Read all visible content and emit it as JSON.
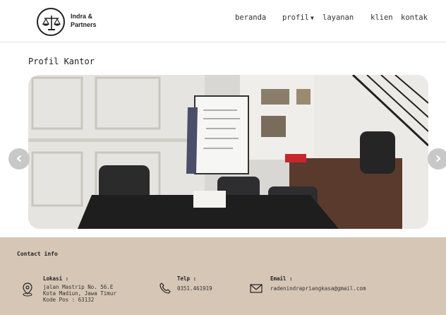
{
  "brand": {
    "name_line1": "Indra &",
    "name_line2": "Partners"
  },
  "nav": {
    "beranda": "beranda",
    "profil": "profil",
    "layanan": "layanan",
    "klien": "klien",
    "kontak": "kontak"
  },
  "main": {
    "title": "Profil Kantor"
  },
  "icons": {
    "logo": "scales-of-justice-icon",
    "dropdown": "chevron-down-icon",
    "carousel_prev": "chevron-left-icon",
    "carousel_next": "chevron-right-icon",
    "location": "location-pin-icon",
    "phone": "phone-icon",
    "email": "envelope-icon"
  },
  "footer": {
    "title": "Contact info",
    "lokasi": {
      "label": "Lokasi :",
      "line1": "jalan Mastrip No. 56.E",
      "line2": "Kota Madiun, Jawa Timur",
      "line3": "Kode Pos : 63132"
    },
    "telp": {
      "label": "Telp :",
      "value": "0351.461919"
    },
    "email": {
      "label": "Email :",
      "value": "radenindrapriangkasa@gmail.com"
    }
  },
  "colors": {
    "footer_bg": "#d6c6b6",
    "header_bg": "#ffffff",
    "arrow_bg": "#c8c8c8"
  }
}
